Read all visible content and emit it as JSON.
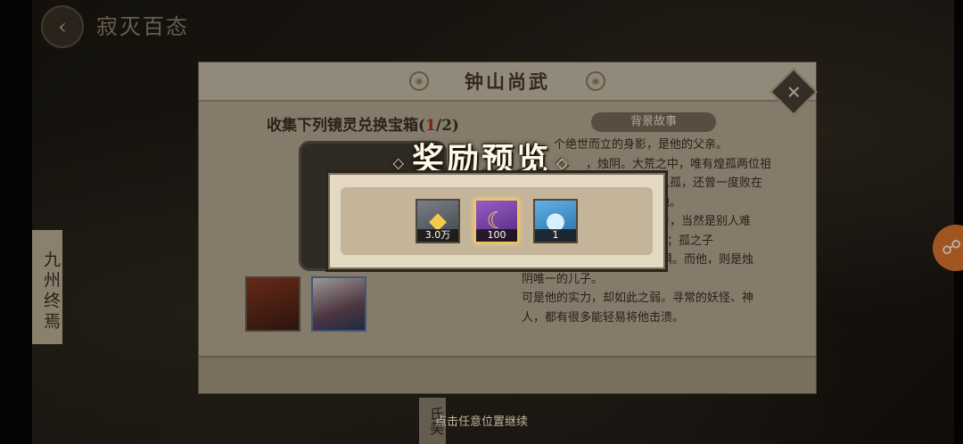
{
  "background": {
    "page_title": "寂灭百态",
    "back_icon": "chevron-left-icon",
    "region_tag": "九州终焉",
    "bottom_tag": "氏美"
  },
  "dialog": {
    "title": "钟山尚武",
    "close_icon": "close-icon",
    "collect_prefix": "收集下列镜灵兑换宝箱(",
    "collect_current": "1",
    "collect_suffix": "/2)",
    "story_tab": "背景故事",
    "story_lines": [
      "个绝世而立的身影，是他的父亲。",
      "，烛阴。大荒之中，唯有煌孤两位祖",
      "，纵孤，还曾一度败在",
      "蔫他。",
      "父亲，当然是别人难",
      "的是大荒众生所景仰；孤之子",
      "便是四凶，为大荒众生所畏惧。而他，则是烛",
      "阴唯一的儿子。",
      "可是他的实力，却如此之弱。寻常的妖怪、神",
      "人，都有很多能轻易将他击溃。"
    ]
  },
  "reward_preview": {
    "title": "奖励预览",
    "items": [
      {
        "name": "gold-ingot-item",
        "icon": "gold-ingot-icon",
        "count": "3.0万",
        "rarity_color": "#7b7f87"
      },
      {
        "name": "gold-token-item",
        "icon": "gold-token-icon",
        "count": "100",
        "rarity_color": "#9a5ac8"
      },
      {
        "name": "blue-spirit-item",
        "icon": "blue-spirit-icon",
        "count": "1",
        "rarity_color": "#5fb2e6"
      }
    ]
  },
  "continue_hint": "点击任意位置继续"
}
